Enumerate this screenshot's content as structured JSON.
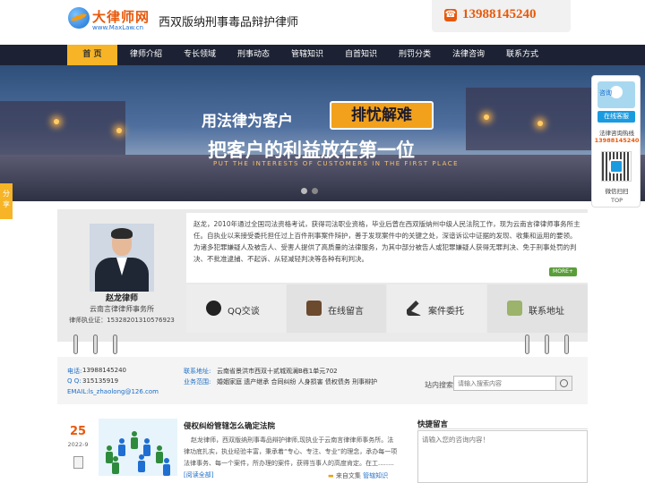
{
  "header": {
    "logo_text": "大律师网",
    "logo_url": "www.MaxLaw.cn",
    "tagline": "西双版纳刑事毒品辩护律师",
    "phone": "13988145240"
  },
  "nav": {
    "items": [
      {
        "label": "首 页"
      },
      {
        "label": "律师介绍"
      },
      {
        "label": "专长领域"
      },
      {
        "label": "刑事动态"
      },
      {
        "label": "管辖知识"
      },
      {
        "label": "自首知识"
      },
      {
        "label": "刑罚分类"
      },
      {
        "label": "法律咨询"
      },
      {
        "label": "联系方式"
      }
    ]
  },
  "banner": {
    "line1": "用法律为客户",
    "line1_box": "排忧解难",
    "line2": "把客户的利益放在第一位",
    "line3": "PUT THE INTERESTS OF CUSTOMERS IN THE FIRST PLACE"
  },
  "share": {
    "label": "分享"
  },
  "float_panel": {
    "consult_label": "咨询",
    "online_service": "在线客服",
    "hotline_label": "法律咨询热线",
    "hotline": "13988145240",
    "wechat_label": "微信扫扫",
    "top_label": "TOP"
  },
  "lawyer": {
    "name": "赵龙律师",
    "firm": "云南言律律师事务所",
    "license": "律师执业证：15328201310576923",
    "description": "赵龙，2010年通过全国司法资格考试，获得司法职业资格，毕业后曾在西双版纳州中级人民法院工作，现为云南言律律师事务所主任。自执业以来接受委托担任过上百件刑事案件辩护，善于发现案件中的关键之处，深谙诉讼中证据的发现、收集和运用的要领。为诸多犯罪嫌疑人及被告人、受害人提供了高质量的法律服务，为其中部分被告人或犯罪嫌疑人获得无罪判决、免于刑事处罚的判决、不批准逮捕、不起诉、从轻减轻判决等各种有利判决。",
    "more": "MORE+"
  },
  "actions": [
    {
      "label": "QQ交谈"
    },
    {
      "label": "在线留言"
    },
    {
      "label": "案件委托"
    },
    {
      "label": "联系地址"
    }
  ],
  "contact": {
    "phone_label": "电话:",
    "phone": "13988145240",
    "qq_label": "Q Q:",
    "qq": "315135919",
    "email": "EMAIL:ls_zhaolong@126.com",
    "address_label": "联系地址:",
    "address": "云南省景洪市西双十贰城观澜B栋1单元702",
    "scope_label": "业务范围:",
    "scope": "婚姻家庭 遗产继承 合同纠纷 人身损害 债权债务 刑事辩护"
  },
  "search": {
    "label": "站内搜索",
    "placeholder": "请输入搜索内容"
  },
  "news": {
    "day": "25",
    "month": "2022-9",
    "title": "侵权纠纷管辖怎么确定法院",
    "body": "赵龙律师，西双版纳刑事毒品辩护律师,现执业于云南言律律师事务所。法律功底扎实，执业经验丰富，秉承着“专心、专注、专业”的理念，承办每一项法律事务、每一个案件，所办理的案件，获得当事人的高度肯定。在工........",
    "read_more": "[阅读全部]",
    "source": "来自文集",
    "category": "管辖知识"
  },
  "quick_message": {
    "title": "快捷留言",
    "placeholder": "请输入您的咨询内容！"
  },
  "colors": {
    "nav_bg": "#1c2233",
    "nav_active": "#f6b426",
    "accent": "#e8590c",
    "link": "#1d6ec7"
  }
}
